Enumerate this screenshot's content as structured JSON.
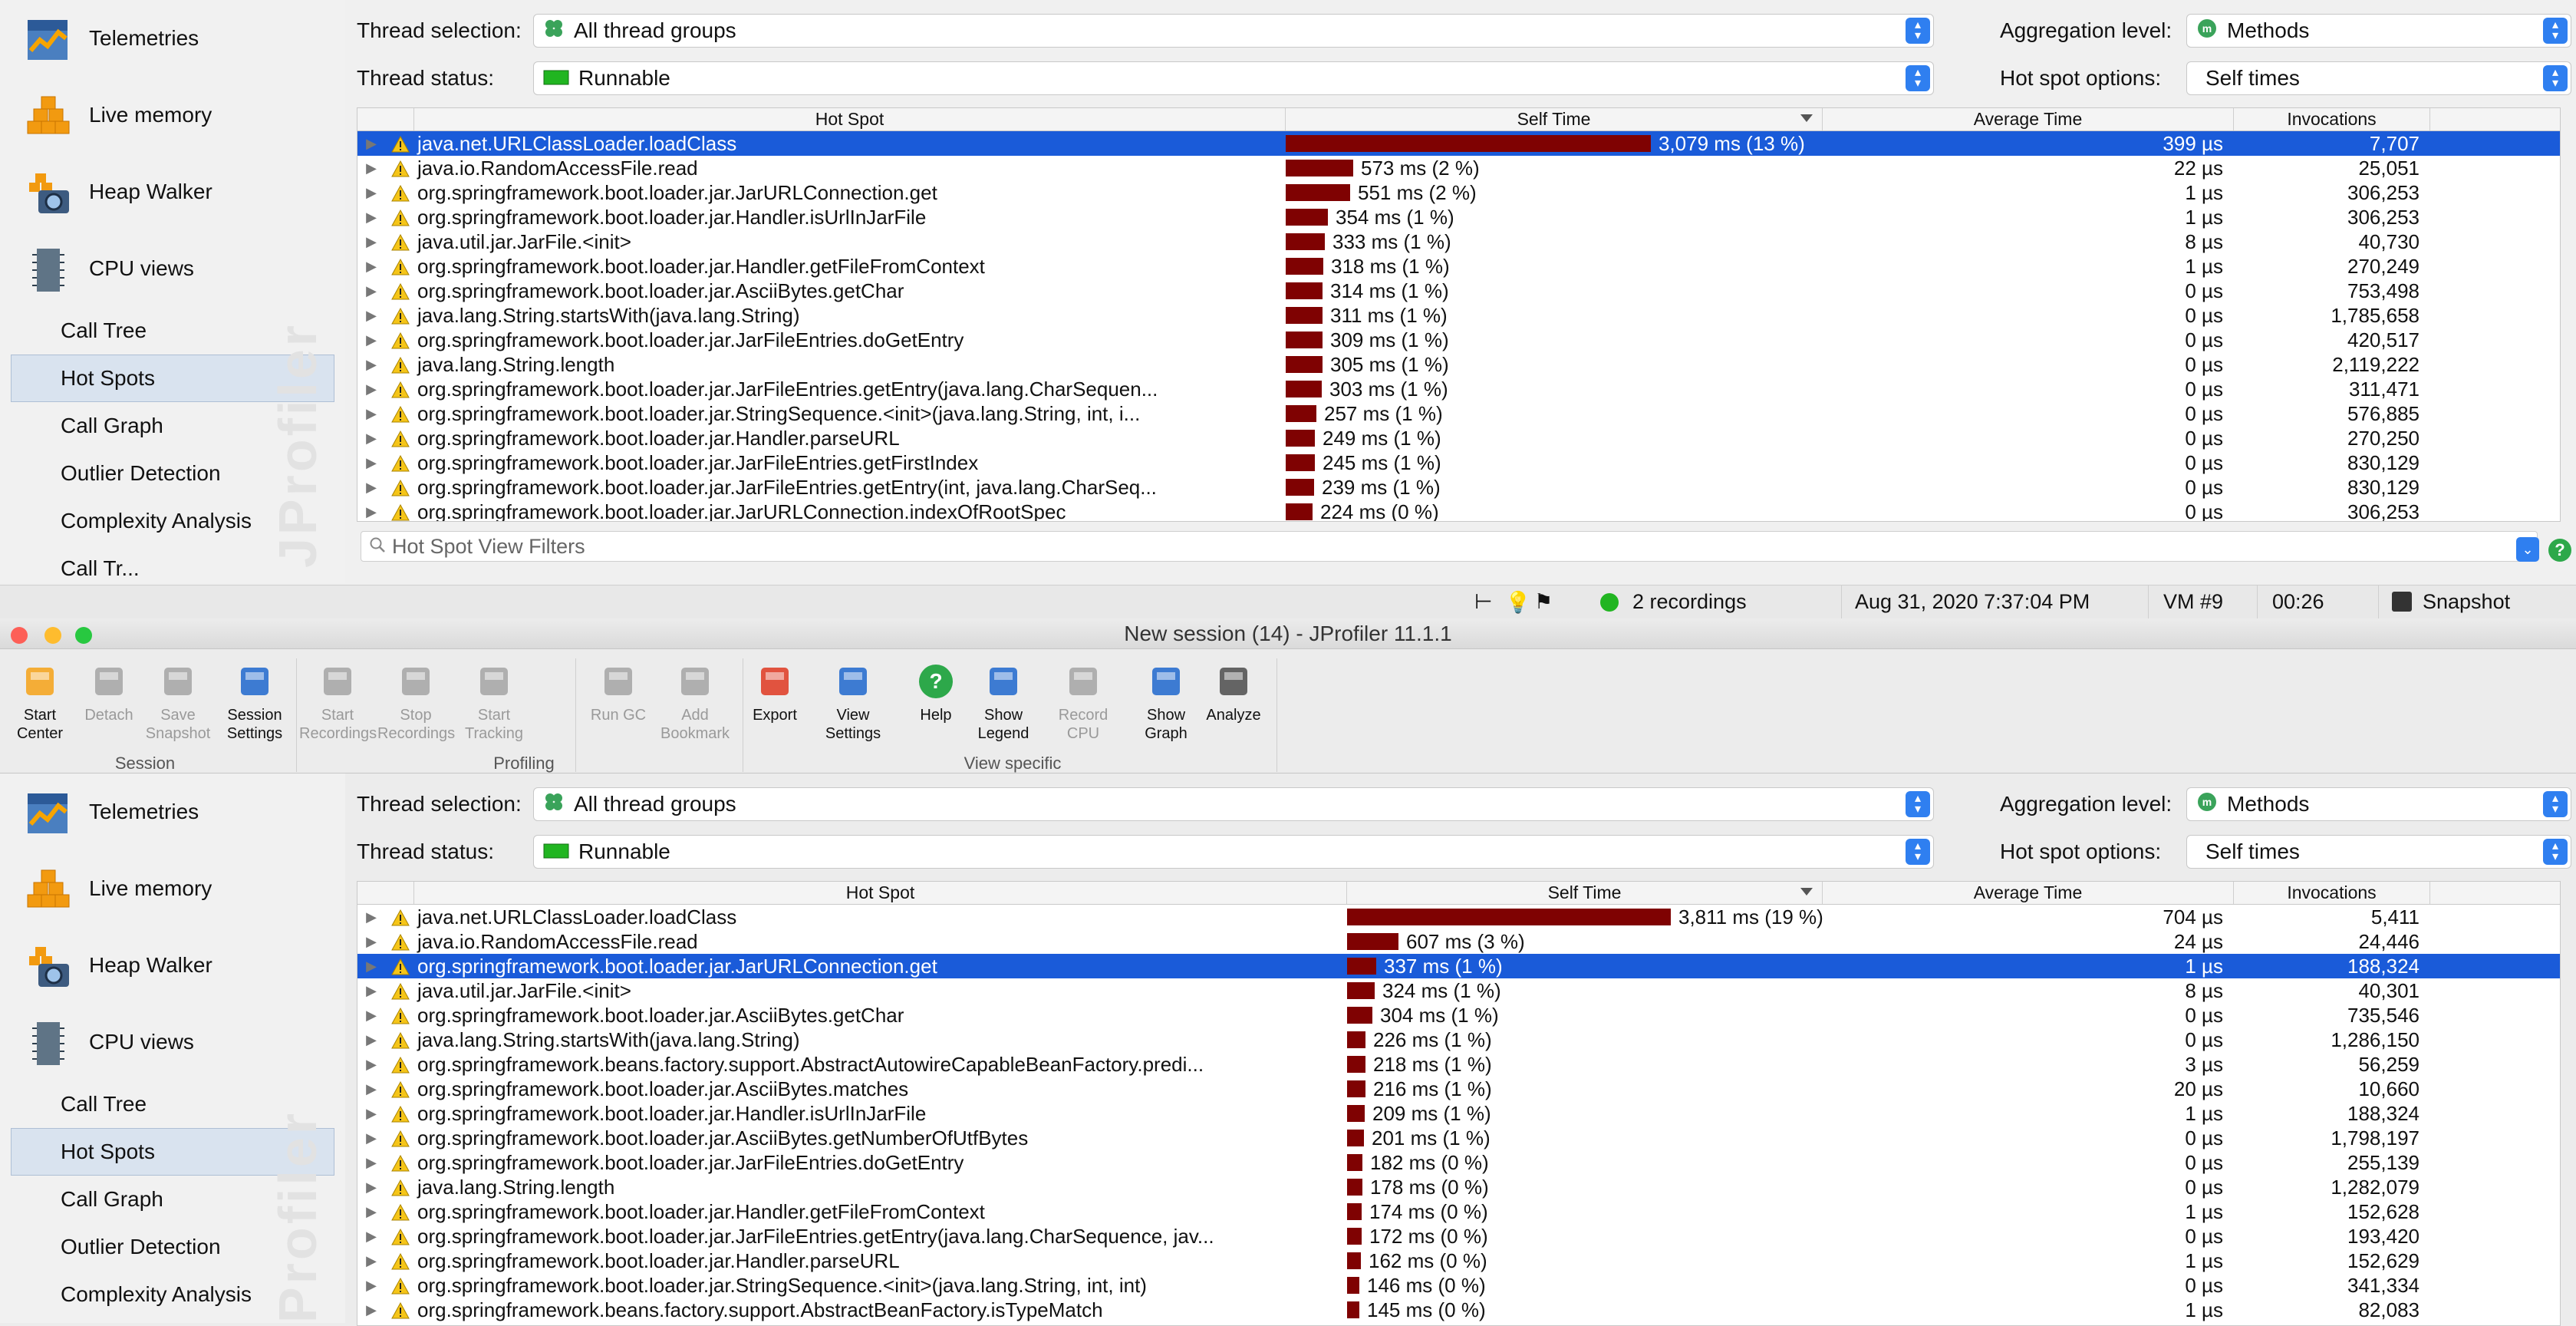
{
  "upper": {
    "sidebar": {
      "views": [
        {
          "label": "Telemetries",
          "icon": "telemetries-icon"
        },
        {
          "label": "Live memory",
          "icon": "live-memory-icon"
        },
        {
          "label": "Heap Walker",
          "icon": "heap-walker-icon"
        },
        {
          "label": "CPU views",
          "icon": "cpu-views-icon"
        }
      ],
      "subviews": [
        "Call Tree",
        "Hot Spots",
        "Call Graph",
        "Outlier Detection",
        "Complexity Analysis",
        "Call Tr..."
      ],
      "selected": "Hot Spots",
      "watermark": "JProfiler"
    },
    "options": {
      "thread_selection_label": "Thread selection:",
      "thread_selection_value": "All thread groups",
      "thread_status_label": "Thread status:",
      "thread_status_value": "Runnable",
      "aggregation_label": "Aggregation level:",
      "aggregation_value": "Methods",
      "hotspot_label": "Hot spot options:",
      "hotspot_value": "Self times"
    },
    "table": {
      "columns": [
        "Hot Spot",
        "Self Time",
        "Average Time",
        "Invocations"
      ],
      "rows": [
        {
          "name": "java.net.URLClassLoader.loadClass",
          "self": "3,079 ms (13 %)",
          "pct": 13,
          "avg": "399 µs",
          "inv": "7,707",
          "selected": true
        },
        {
          "name": "java.io.RandomAccessFile.read",
          "self": "573 ms (2 %)",
          "pct": 2.4,
          "avg": "22 µs",
          "inv": "25,051"
        },
        {
          "name": "org.springframework.boot.loader.jar.JarURLConnection.get",
          "self": "551 ms (2 %)",
          "pct": 2.3,
          "avg": "1 µs",
          "inv": "306,253"
        },
        {
          "name": "org.springframework.boot.loader.jar.Handler.isUrlInJarFile",
          "self": "354 ms (1 %)",
          "pct": 1.5,
          "avg": "1 µs",
          "inv": "306,253"
        },
        {
          "name": "java.util.jar.JarFile.<init>",
          "self": "333 ms (1 %)",
          "pct": 1.4,
          "avg": "8 µs",
          "inv": "40,730"
        },
        {
          "name": "org.springframework.boot.loader.jar.Handler.getFileFromContext",
          "self": "318 ms (1 %)",
          "pct": 1.35,
          "avg": "1 µs",
          "inv": "270,249"
        },
        {
          "name": "org.springframework.boot.loader.jar.AsciiBytes.getChar",
          "self": "314 ms (1 %)",
          "pct": 1.3,
          "avg": "0 µs",
          "inv": "753,498"
        },
        {
          "name": "java.lang.String.startsWith(java.lang.String)",
          "self": "311 ms (1 %)",
          "pct": 1.3,
          "avg": "0 µs",
          "inv": "1,785,658"
        },
        {
          "name": "org.springframework.boot.loader.jar.JarFileEntries.doGetEntry",
          "self": "309 ms (1 %)",
          "pct": 1.3,
          "avg": "0 µs",
          "inv": "420,517"
        },
        {
          "name": "java.lang.String.length",
          "self": "305 ms (1 %)",
          "pct": 1.3,
          "avg": "0 µs",
          "inv": "2,119,222"
        },
        {
          "name": "org.springframework.boot.loader.jar.JarFileEntries.getEntry(java.lang.CharSequen...",
          "self": "303 ms (1 %)",
          "pct": 1.28,
          "avg": "0 µs",
          "inv": "311,471"
        },
        {
          "name": "org.springframework.boot.loader.jar.StringSequence.<init>(java.lang.String, int, i...",
          "self": "257 ms (1 %)",
          "pct": 1.1,
          "avg": "0 µs",
          "inv": "576,885"
        },
        {
          "name": "org.springframework.boot.loader.jar.Handler.parseURL",
          "self": "249 ms (1 %)",
          "pct": 1.05,
          "avg": "0 µs",
          "inv": "270,250"
        },
        {
          "name": "org.springframework.boot.loader.jar.JarFileEntries.getFirstIndex",
          "self": "245 ms (1 %)",
          "pct": 1.03,
          "avg": "0 µs",
          "inv": "830,129"
        },
        {
          "name": "org.springframework.boot.loader.jar.JarFileEntries.getEntry(int, java.lang.CharSeq...",
          "self": "239 ms (1 %)",
          "pct": 1.0,
          "avg": "0 µs",
          "inv": "830,129"
        },
        {
          "name": "org.springframework.boot.loader.jar.JarURLConnection.indexOfRootSpec",
          "self": "224 ms (0 %)",
          "pct": 0.95,
          "avg": "0 µs",
          "inv": "306,253"
        }
      ]
    },
    "filter_placeholder": "Hot Spot View Filters",
    "status": {
      "recordings": "2 recordings",
      "datetime": "Aug 31, 2020 7:37:04 PM",
      "vm": "VM #9",
      "elapsed": "00:26",
      "snapshot": "Snapshot"
    }
  },
  "lower": {
    "window_title": "New session (14) - JProfiler 11.1.1",
    "toolbar": {
      "groups": [
        "Session",
        "Profiling",
        "View specific"
      ],
      "buttons": [
        {
          "label": "Start\nCenter",
          "enabled": true
        },
        {
          "label": "Detach",
          "enabled": false
        },
        {
          "label": "Save\nSnapshot",
          "enabled": false
        },
        {
          "label": "Session\nSettings",
          "enabled": true
        },
        {
          "label": "Start\nRecordings",
          "enabled": false
        },
        {
          "label": "Stop\nRecordings",
          "enabled": false
        },
        {
          "label": "Start\nTracking",
          "enabled": false
        },
        {
          "label": "Run GC",
          "enabled": false
        },
        {
          "label": "Add\nBookmark",
          "enabled": false
        },
        {
          "label": "Export",
          "enabled": true
        },
        {
          "label": "View\nSettings",
          "enabled": true
        },
        {
          "label": "Help",
          "enabled": true
        },
        {
          "label": "Show\nLegend",
          "enabled": true
        },
        {
          "label": "Record\nCPU",
          "enabled": false
        },
        {
          "label": "Show\nGraph",
          "enabled": true
        },
        {
          "label": "Analyze",
          "enabled": true
        }
      ]
    },
    "sidebar": {
      "views": [
        {
          "label": "Telemetries",
          "icon": "telemetries-icon"
        },
        {
          "label": "Live memory",
          "icon": "live-memory-icon"
        },
        {
          "label": "Heap Walker",
          "icon": "heap-walker-icon"
        },
        {
          "label": "CPU views",
          "icon": "cpu-views-icon"
        }
      ],
      "subviews": [
        "Call Tree",
        "Hot Spots",
        "Call Graph",
        "Outlier Detection",
        "Complexity Analysis"
      ],
      "selected": "Hot Spots",
      "watermark": "Profiler"
    },
    "options": {
      "thread_selection_label": "Thread selection:",
      "thread_selection_value": "All thread groups",
      "thread_status_label": "Thread status:",
      "thread_status_value": "Runnable",
      "aggregation_label": "Aggregation level:",
      "aggregation_value": "Methods",
      "hotspot_label": "Hot spot options:",
      "hotspot_value": "Self times"
    },
    "table": {
      "columns": [
        "Hot Spot",
        "Self Time",
        "Average Time",
        "Invocations"
      ],
      "rows": [
        {
          "name": "java.net.URLClassLoader.loadClass",
          "self": "3,811 ms (19 %)",
          "pct": 19,
          "avg": "704 µs",
          "inv": "5,411"
        },
        {
          "name": "java.io.RandomAccessFile.read",
          "self": "607 ms (3 %)",
          "pct": 3.0,
          "avg": "24 µs",
          "inv": "24,446"
        },
        {
          "name": "org.springframework.boot.loader.jar.JarURLConnection.get",
          "self": "337 ms (1 %)",
          "pct": 1.7,
          "avg": "1 µs",
          "inv": "188,324",
          "selected": true
        },
        {
          "name": "java.util.jar.JarFile.<init>",
          "self": "324 ms (1 %)",
          "pct": 1.6,
          "avg": "8 µs",
          "inv": "40,301"
        },
        {
          "name": "org.springframework.boot.loader.jar.AsciiBytes.getChar",
          "self": "304 ms (1 %)",
          "pct": 1.5,
          "avg": "0 µs",
          "inv": "735,546"
        },
        {
          "name": "java.lang.String.startsWith(java.lang.String)",
          "self": "226 ms (1 %)",
          "pct": 1.1,
          "avg": "0 µs",
          "inv": "1,286,150"
        },
        {
          "name": "org.springframework.beans.factory.support.AbstractAutowireCapableBeanFactory.predi...",
          "self": "218 ms (1 %)",
          "pct": 1.08,
          "avg": "3 µs",
          "inv": "56,259"
        },
        {
          "name": "org.springframework.boot.loader.jar.AsciiBytes.matches",
          "self": "216 ms (1 %)",
          "pct": 1.07,
          "avg": "20 µs",
          "inv": "10,660"
        },
        {
          "name": "org.springframework.boot.loader.jar.Handler.isUrlInJarFile",
          "self": "209 ms (1 %)",
          "pct": 1.04,
          "avg": "1 µs",
          "inv": "188,324"
        },
        {
          "name": "org.springframework.boot.loader.jar.AsciiBytes.getNumberOfUtfBytes",
          "self": "201 ms (1 %)",
          "pct": 1.0,
          "avg": "0 µs",
          "inv": "1,798,197"
        },
        {
          "name": "org.springframework.boot.loader.jar.JarFileEntries.doGetEntry",
          "self": "182 ms (0 %)",
          "pct": 0.9,
          "avg": "0 µs",
          "inv": "255,139"
        },
        {
          "name": "java.lang.String.length",
          "self": "178 ms (0 %)",
          "pct": 0.88,
          "avg": "0 µs",
          "inv": "1,282,079"
        },
        {
          "name": "org.springframework.boot.loader.jar.Handler.getFileFromContext",
          "self": "174 ms (0 %)",
          "pct": 0.86,
          "avg": "1 µs",
          "inv": "152,628"
        },
        {
          "name": "org.springframework.boot.loader.jar.JarFileEntries.getEntry(java.lang.CharSequence, jav...",
          "self": "172 ms (0 %)",
          "pct": 0.85,
          "avg": "0 µs",
          "inv": "193,420"
        },
        {
          "name": "org.springframework.boot.loader.jar.Handler.parseURL",
          "self": "162 ms (0 %)",
          "pct": 0.8,
          "avg": "1 µs",
          "inv": "152,629"
        },
        {
          "name": "org.springframework.boot.loader.jar.StringSequence.<init>(java.lang.String, int, int)",
          "self": "146 ms (0 %)",
          "pct": 0.72,
          "avg": "0 µs",
          "inv": "341,334"
        },
        {
          "name": "org.springframework.beans.factory.support.AbstractBeanFactory.isTypeMatch",
          "self": "145 ms (0 %)",
          "pct": 0.71,
          "avg": "1 µs",
          "inv": "82,083"
        }
      ]
    }
  },
  "colors": {
    "selection": "#1a5bd9",
    "bar": "#7f0202",
    "combo_arrow": "#2f7ff0",
    "runnable_green": "#21b521",
    "methods_green": "#3aa35a",
    "warn_yellow": "#f5c518"
  }
}
